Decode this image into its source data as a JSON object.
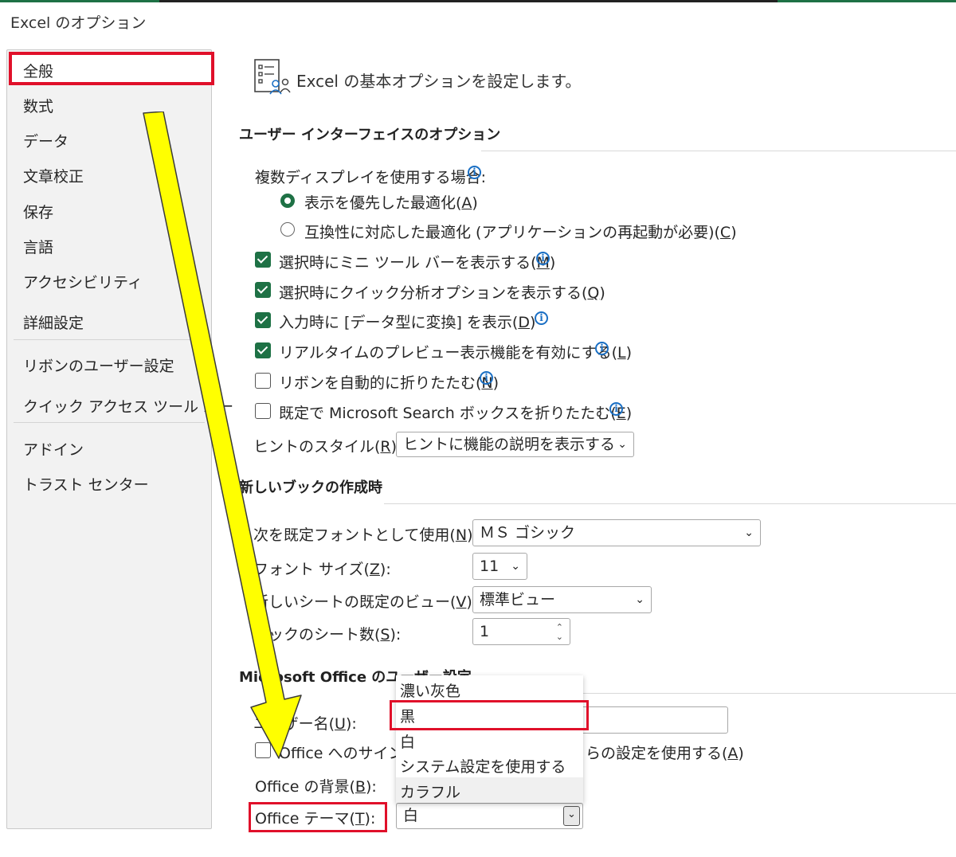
{
  "window": {
    "title": "Excel のオプション"
  },
  "sidebar": {
    "items": [
      {
        "label": "全般"
      },
      {
        "label": "数式"
      },
      {
        "label": "データ"
      },
      {
        "label": "文章校正"
      },
      {
        "label": "保存"
      },
      {
        "label": "言語"
      },
      {
        "label": "アクセシビリティ"
      },
      {
        "label": "詳細設定"
      },
      {
        "label": "リボンのユーザー設定"
      },
      {
        "label": "クイック アクセス ツール バー"
      },
      {
        "label": "アドイン"
      },
      {
        "label": "トラスト センター"
      }
    ],
    "selected": "全般"
  },
  "header": {
    "text": "Excel の基本オプションを設定します。"
  },
  "ui_options": {
    "title": "ユーザー インターフェイスのオプション",
    "multi_display_label": "複数ディスプレイを使用する場合:",
    "radio_display_pre": "表示を優先した最適化(",
    "radio_display_key": "A",
    "radio_compat_pre": "互換性に対応した最適化 (アプリケーションの再起動が必要)(",
    "radio_compat_key": "C",
    "cb_mini_pre": "選択時にミニ ツール バーを表示する(",
    "cb_mini_key": "M",
    "cb_quick_pre": "選択時にクイック分析オプションを表示する(",
    "cb_quick_key": "Q",
    "cb_convert_pre": "入力時に [データ型に変換] を表示(",
    "cb_convert_key": "D",
    "cb_preview_pre": "リアルタイムのプレビュー表示機能を有効にする(",
    "cb_preview_key": "L",
    "cb_ribbon_pre": "リボンを自動的に折りたたむ(",
    "cb_ribbon_key": "N",
    "cb_search_pre": "既定で Microsoft Search ボックスを折りたたむ(",
    "cb_search_key": "E",
    "close_paren": ")",
    "hint_label_pre": "ヒントのスタイル(",
    "hint_label_key": "R",
    "hint_label_post": "):",
    "hint_value": "ヒントに機能の説明を表示する"
  },
  "new_book": {
    "title": "新しいブックの作成時",
    "font_label_pre": "次を既定フォントとして使用(",
    "font_label_key": "N",
    "font_value": "ＭＳ ゴシック",
    "size_label_pre": "フォント サイズ(",
    "size_label_key": "Z",
    "size_value": "11",
    "view_label_pre": "新しいシートの既定のビュー(",
    "view_label_key": "V",
    "view_value": "標準ビュー",
    "sheets_label_pre": "ブックのシート数(",
    "sheets_label_key": "S",
    "sheets_value": "1",
    "label_post": "):"
  },
  "office": {
    "title": "Microsoft Office のユーザー設定",
    "username_pre": "ユーザー名(",
    "username_key": "U",
    "username_post": "):",
    "signin_pre": "Office へのサインイン",
    "signin_post": "らの設定を使用する(",
    "signin_key": "A",
    "background_pre": "Office の背景(",
    "background_key": "B",
    "background_post": "):",
    "theme_pre": "Office テーマ(",
    "theme_key": "T",
    "theme_post": "):",
    "theme_value": "白",
    "theme_options": [
      "濃い灰色",
      "黒",
      "白",
      "システム設定を使用する",
      "カラフル"
    ]
  },
  "colors": {
    "accent": "#1e7145",
    "highlight": "#e0102a",
    "arrow": "#ffff00"
  }
}
